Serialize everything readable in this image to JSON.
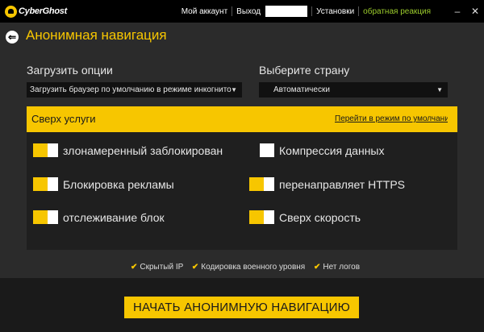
{
  "app": {
    "logo_text": "CyberGhost"
  },
  "topnav": {
    "account": "Мой аккаунт",
    "logout": "Выход",
    "settings": "Установки",
    "feedback": "обратная реакция",
    "minimize": "–",
    "close": "✕"
  },
  "header": {
    "back": "⇐",
    "title": "Анонимная навигация"
  },
  "options": {
    "load_label": "Загрузить опции",
    "load_value": "Загрузить браузер по умолчанию в режиме инкогнито",
    "country_label": "Выберите страну",
    "country_value": "Автоматически",
    "arrow": "▼"
  },
  "section": {
    "title": "Сверх услуги",
    "link": "Перейти в режим по умолчанию",
    "items": [
      {
        "label": "злонамеренный заблокирован",
        "on": true
      },
      {
        "label": "Компрессия данных",
        "on": false
      },
      {
        "label": "Блокировка рекламы",
        "on": true
      },
      {
        "label": "перенаправляет HTTPS",
        "on": true
      },
      {
        "label": "отслеживание блок",
        "on": true
      },
      {
        "label": "Сверх скорость",
        "on": true
      }
    ]
  },
  "features": {
    "check": "✔",
    "items": [
      "Скрытый IP",
      "Кодировка военного уровня",
      "Нет логов"
    ]
  },
  "start_button": "НАЧАТЬ АНОНИМНУЮ НАВИГАЦИЮ",
  "colors": {
    "accent": "#f7c600",
    "feedback": "#9ccc2c",
    "background": "#2b2b2b"
  }
}
